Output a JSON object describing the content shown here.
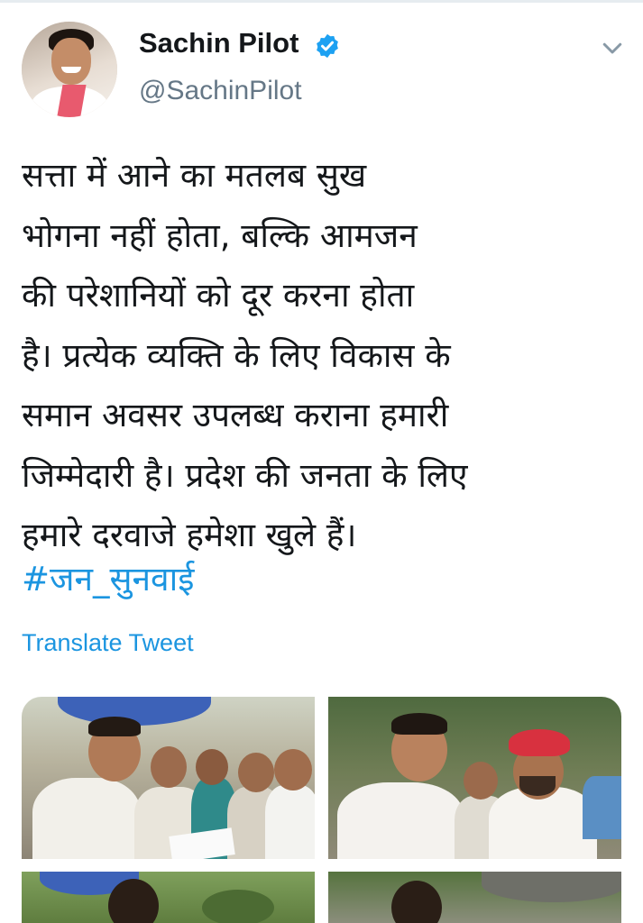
{
  "author": {
    "name": "Sachin Pilot",
    "handle": "@SachinPilot",
    "verified_icon": "verified-badge-icon"
  },
  "tweet": {
    "lines": [
      "सत्ता में आने का मतलब सुख",
      "भोगना नहीं होता, बल्कि आमजन",
      "की परेशानियों को दूर करना होता",
      "है। प्रत्येक व्यक्ति के लिए विकास के",
      "समान अवसर उपलब्ध कराना हमारी",
      "जिम्मेदारी है। प्रदेश की जनता के लिए",
      "हमारे दरवाजे हमेशा खुले हैं।"
    ],
    "hashtag": "#जन_सुनवाई",
    "translate_label": "Translate Tweet"
  },
  "colors": {
    "link": "#1b95e0",
    "secondary_text": "#657786",
    "primary_text": "#14171a",
    "verified": "#1da1f2"
  },
  "icons": [
    "verified-badge-icon",
    "chevron-down-icon"
  ]
}
